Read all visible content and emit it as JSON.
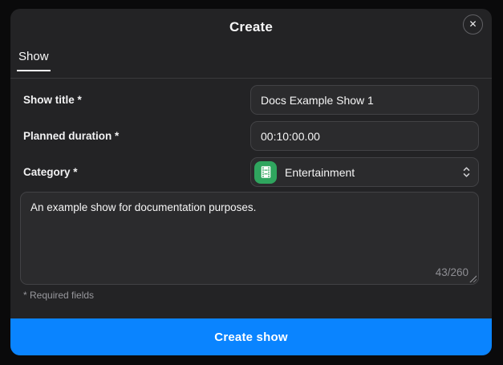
{
  "dialog": {
    "title": "Create",
    "close_icon": "✕"
  },
  "tabs": [
    {
      "label": "Show",
      "active": true
    }
  ],
  "form": {
    "show_title": {
      "label": "Show title *",
      "value": "Docs Example Show 1"
    },
    "planned_duration": {
      "label": "Planned duration *",
      "value": "00:10:00.00"
    },
    "category": {
      "label": "Category *",
      "selected": "Entertainment"
    },
    "description": {
      "value": "An example show for documentation purposes.",
      "char_counter": "43/260"
    },
    "required_note": "* Required fields"
  },
  "footer": {
    "submit_label": "Create show"
  },
  "colors": {
    "accent_blue": "#0a84ff",
    "category_green": "#2fa55e"
  }
}
